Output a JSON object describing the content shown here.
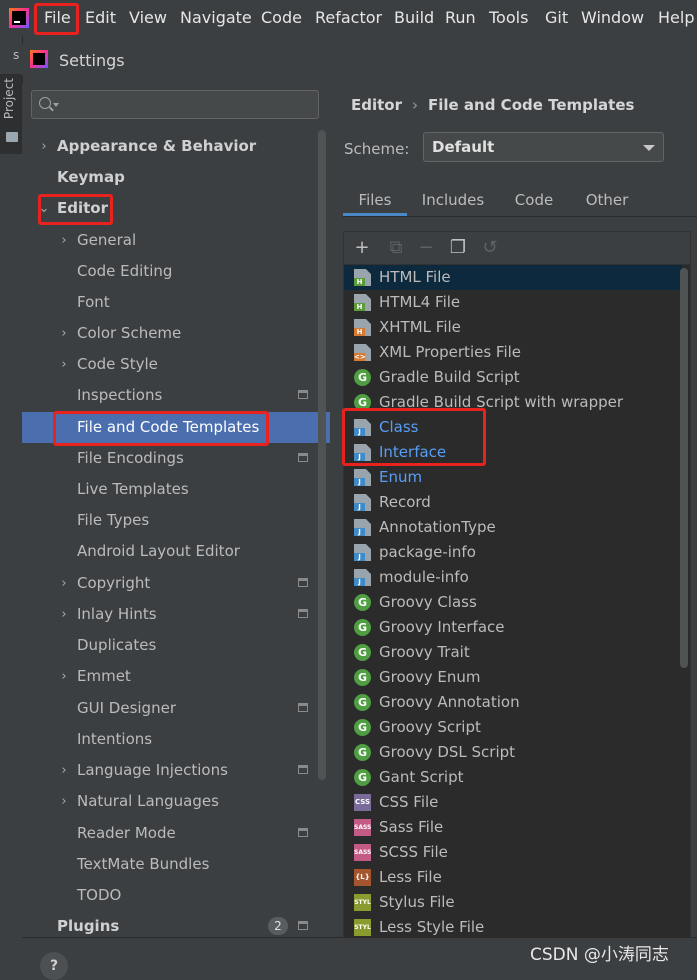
{
  "menubar": {
    "items": [
      "File",
      "Edit",
      "View",
      "Navigate",
      "Code",
      "Refactor",
      "Build",
      "Run",
      "Tools",
      "Git",
      "Window",
      "Help"
    ]
  },
  "strip": {
    "top_letter": "s",
    "project_tab": "Project"
  },
  "dialog": {
    "title": "Settings"
  },
  "sidebar": {
    "search_placeholder": "",
    "items": [
      {
        "label": "Appearance & Behavior",
        "expander": "›"
      },
      {
        "label": "Keymap"
      },
      {
        "label": "Editor",
        "expander": "⌄"
      },
      {
        "label": "General",
        "expander": "›"
      },
      {
        "label": "Code Editing"
      },
      {
        "label": "Font"
      },
      {
        "label": "Color Scheme",
        "expander": "›"
      },
      {
        "label": "Code Style",
        "expander": "›"
      },
      {
        "label": "Inspections"
      },
      {
        "label": "File and Code Templates"
      },
      {
        "label": "File Encodings"
      },
      {
        "label": "Live Templates"
      },
      {
        "label": "File Types"
      },
      {
        "label": "Android Layout Editor"
      },
      {
        "label": "Copyright",
        "expander": "›"
      },
      {
        "label": "Inlay Hints",
        "expander": "›"
      },
      {
        "label": "Duplicates"
      },
      {
        "label": "Emmet",
        "expander": "›"
      },
      {
        "label": "GUI Designer"
      },
      {
        "label": "Intentions"
      },
      {
        "label": "Language Injections",
        "expander": "›"
      },
      {
        "label": "Natural Languages",
        "expander": "›"
      },
      {
        "label": "Reader Mode"
      },
      {
        "label": "TextMate Bundles"
      },
      {
        "label": "TODO"
      },
      {
        "label": "Plugins",
        "badge": "2"
      }
    ]
  },
  "content": {
    "breadcrumb": [
      "Editor",
      "File and Code Templates"
    ],
    "breadcrumb_sep": "›",
    "scheme_label": "Scheme:",
    "scheme_value": "Default",
    "tabs": [
      "Files",
      "Includes",
      "Code",
      "Other"
    ],
    "toolbar": {
      "add": "+",
      "copy": "⧉",
      "remove": "−",
      "duplicate": "❐",
      "reset": "↺"
    },
    "files": [
      {
        "name": "HTML File",
        "icon": "H"
      },
      {
        "name": "HTML4 File",
        "icon": "H"
      },
      {
        "name": "XHTML File",
        "icon": "H"
      },
      {
        "name": "XML Properties File",
        "icon": "<>"
      },
      {
        "name": "Gradle Build Script",
        "icon": "G"
      },
      {
        "name": "Gradle Build Script with wrapper",
        "icon": "G"
      },
      {
        "name": "Class",
        "icon": "J"
      },
      {
        "name": "Interface",
        "icon": "J"
      },
      {
        "name": "Enum",
        "icon": "J"
      },
      {
        "name": "Record",
        "icon": "J"
      },
      {
        "name": "AnnotationType",
        "icon": "J"
      },
      {
        "name": "package-info",
        "icon": "J"
      },
      {
        "name": "module-info",
        "icon": "J"
      },
      {
        "name": "Groovy Class",
        "icon": "G"
      },
      {
        "name": "Groovy Interface",
        "icon": "G"
      },
      {
        "name": "Groovy Trait",
        "icon": "G"
      },
      {
        "name": "Groovy Enum",
        "icon": "G"
      },
      {
        "name": "Groovy Annotation",
        "icon": "G"
      },
      {
        "name": "Groovy Script",
        "icon": "G"
      },
      {
        "name": "Groovy DSL Script",
        "icon": "G"
      },
      {
        "name": "Gant Script",
        "icon": "G"
      },
      {
        "name": "CSS File",
        "icon": "CSS"
      },
      {
        "name": "Sass File",
        "icon": "SASS"
      },
      {
        "name": "SCSS File",
        "icon": "SASS"
      },
      {
        "name": "Less File",
        "icon": "{L}"
      },
      {
        "name": "Stylus File",
        "icon": "STYL"
      },
      {
        "name": "Less Style File",
        "icon": "STYL"
      }
    ]
  },
  "bottom": {
    "help": "?",
    "watermark": "CSDN @小涛同志"
  },
  "colors": {
    "accent": "#4b6eaf",
    "link_blue": "#589df6",
    "highlight_red": "#e8231f"
  }
}
